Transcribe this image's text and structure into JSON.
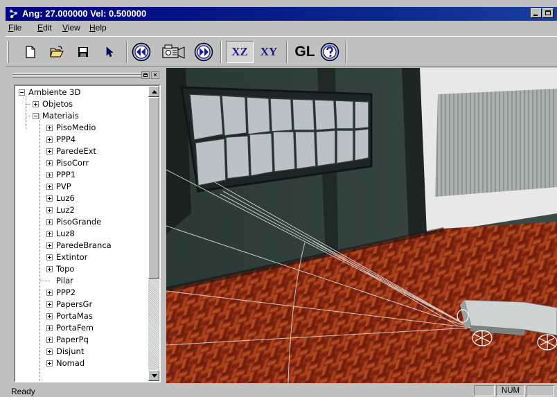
{
  "window": {
    "title": "Ang: 27.000000 Vel: 0.500000",
    "icon": "app-icon"
  },
  "menu": {
    "file": "ile",
    "file_mnemonic": "F",
    "edit": "dit",
    "edit_mnemonic": "E",
    "view": "iew",
    "view_mnemonic": "V",
    "help": "elp",
    "help_mnemonic": "H"
  },
  "toolbar": {
    "buttons": [
      {
        "name": "new-file-icon"
      },
      {
        "name": "open-folder-icon"
      },
      {
        "name": "save-disk-icon"
      },
      {
        "name": "select-arrow-icon"
      },
      {
        "name": "rewind-icon"
      },
      {
        "name": "camera-icon"
      },
      {
        "name": "forward-icon"
      },
      {
        "name": "plane-xz",
        "label": "XZ",
        "pressed": true
      },
      {
        "name": "plane-xy",
        "label": "XY",
        "pressed": false
      },
      {
        "name": "opengl",
        "label": "GL"
      },
      {
        "name": "help-icon"
      }
    ],
    "xz_label": "XZ",
    "xy_label": "XY",
    "gl_label": "GL"
  },
  "tree": {
    "root": "Ambiente 3D",
    "objetos": "Objetos",
    "materiais": "Materiais",
    "materials": [
      "PisoMedio",
      "PPP4",
      "ParedeExt",
      "PisoCorr",
      "PPP1",
      "PVP",
      "Luz6",
      "Luz2",
      "PisoGrande",
      "Luz8",
      "ParedeBranca",
      "Extintor",
      "Topo",
      "Pilar",
      "PPP2",
      "PapersGr",
      "PortaMas",
      "PortaFem",
      "PaperPq",
      "Disjunt",
      "Nomad"
    ],
    "leaf_items": [
      "Pilar"
    ]
  },
  "status": {
    "text": "Ready",
    "num": "NUM"
  },
  "colors": {
    "title_bg": "#000080",
    "face": "#c0c0c0",
    "floor": "#8a2a14",
    "wall": "#2f3f3b"
  }
}
